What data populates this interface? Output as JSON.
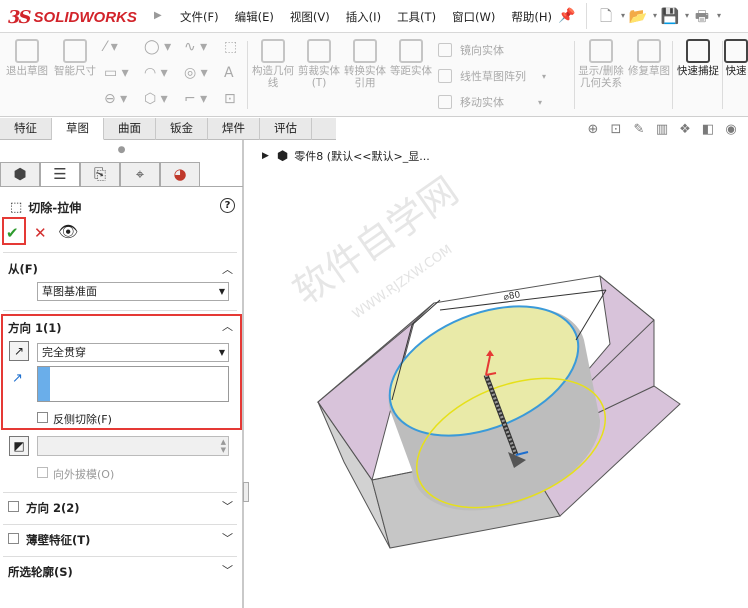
{
  "app": {
    "logo_text": "SOLIDWORKS",
    "logo_mark": "3S"
  },
  "menu": [
    {
      "label": "文件(F)"
    },
    {
      "label": "编辑(E)"
    },
    {
      "label": "视图(V)"
    },
    {
      "label": "插入(I)"
    },
    {
      "label": "工具(T)"
    },
    {
      "label": "窗口(W)"
    },
    {
      "label": "帮助(H)"
    }
  ],
  "ribbon": {
    "exit_sketch": "退出草图",
    "smart_dim": "智能尺寸",
    "construct": "构造几何线",
    "trim": "剪裁实体(T)",
    "convert": "转换实体引用",
    "offset": "等距实体",
    "mirror": "镜向实体",
    "linear_pattern": "线性草图阵列",
    "move": "移动实体",
    "show_delete": "显示/删除几何关系",
    "repair": "修复草图",
    "quick_snap": "快速捕捉",
    "quick_view": "快速"
  },
  "cm_tabs": [
    {
      "label": "特征"
    },
    {
      "label": "草图"
    },
    {
      "label": "曲面"
    },
    {
      "label": "钣金"
    },
    {
      "label": "焊件"
    },
    {
      "label": "评估"
    }
  ],
  "tree": {
    "label": "零件8 (默认<<默认>_显..."
  },
  "panel": {
    "feature_title": "切除-拉伸",
    "help": "?",
    "from_label": "从(F)",
    "from_value": "草图基准面",
    "dir1_label": "方向 1(1)",
    "dir1_value": "完全贯穿",
    "flip_cut": "反侧切除(F)",
    "draft_outward": "向外拔模(O)",
    "dir2_label": "方向 2(2)",
    "thin_label": "薄壁特征(T)",
    "contours_label": "所选轮廓(S)"
  },
  "model": {
    "dim_label": "⌀80"
  },
  "watermark": {
    "cn": "软件自学网",
    "url": "WWW.RJZXW.COM"
  },
  "colors": {
    "brand": "#d2232a",
    "highlight": "#e53935",
    "ok": "#2e9b2e",
    "select": "#6aaeea",
    "face_purple": "#d8c3da",
    "cylinder_yellow": "#f1f2a4"
  }
}
